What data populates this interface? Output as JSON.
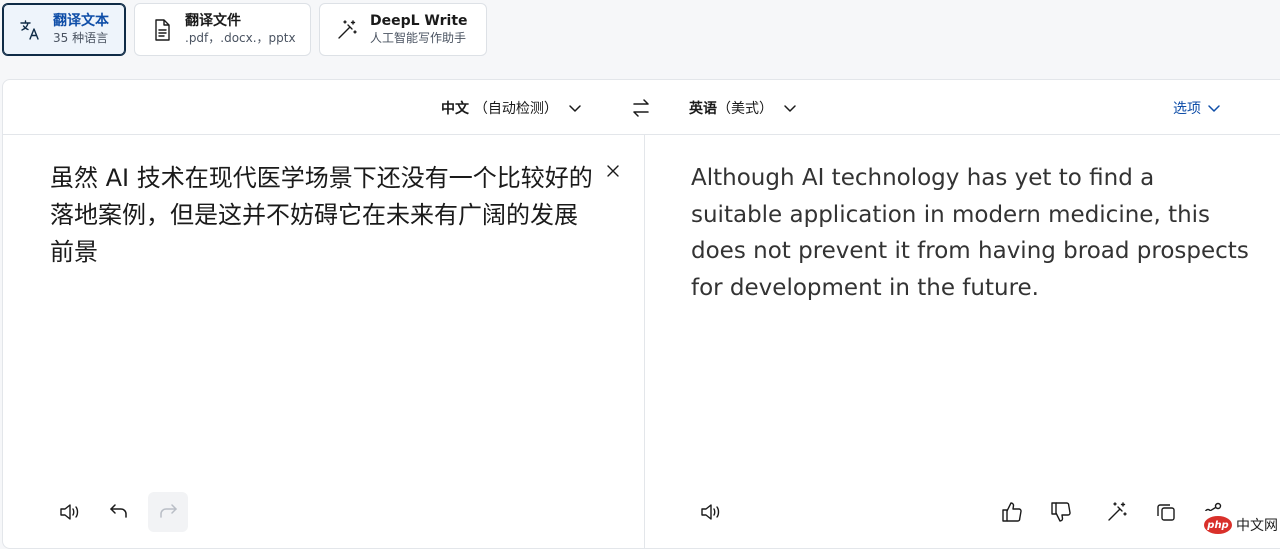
{
  "mode_tabs": [
    {
      "title": "翻译文本",
      "subtitle": "35 种语言"
    },
    {
      "title": "翻译文件",
      "subtitle": ".pdf，.docx.，pptx"
    },
    {
      "title": "DeepL Write",
      "subtitle": "人工智能写作助手"
    }
  ],
  "source_language": {
    "name": "中文",
    "detail": "（自动检测）"
  },
  "target_language": {
    "name": "英语",
    "detail": "（美式）"
  },
  "options_label": "选项",
  "source_text": "虽然 AI 技术在现代医学场景下还没有一个比较好的落地案例，但是这并不妨碍它在未来有广阔的发展前景",
  "translated_text": "Although AI technology has yet to find a suitable application in modern medicine, this does not prevent it from having broad prospects for development in the future.",
  "watermark": {
    "logo": "php",
    "text": "中文网"
  },
  "colors": {
    "accent": "#0f4ea8",
    "active_border": "#0f2b46",
    "watermark_red": "#d9302a"
  },
  "icons": [
    "translate-text-icon",
    "document-icon",
    "magic-wand-icon",
    "chevron-down-icon",
    "swap-icon",
    "close-icon",
    "speaker-icon",
    "undo-icon",
    "redo-icon",
    "thumbs-up-icon",
    "thumbs-down-icon",
    "wand-sparkle-icon",
    "copy-icon",
    "share-icon"
  ]
}
